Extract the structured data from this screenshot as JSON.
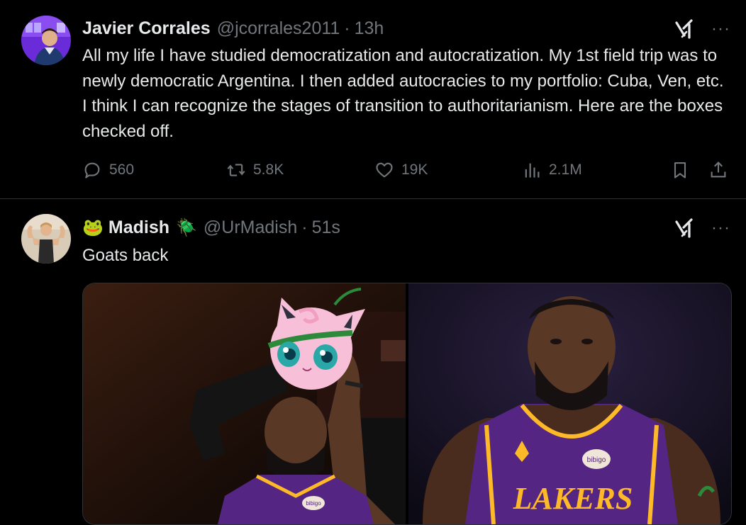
{
  "tweets": [
    {
      "author_name": "Javier Corrales",
      "handle": "@jcorrales2011",
      "separator": "·",
      "time": "13h",
      "text": "All my life I have studied democratization and autocratization. My 1st field trip was to newly democratic Argentina. I then added autocracies to my portfolio: Cuba, Ven, etc. I think I can recognize the stages of transition to authoritarianism. Here are the boxes checked off.",
      "more_label": "···",
      "stats": {
        "replies": "560",
        "reposts": "5.8K",
        "likes": "19K",
        "views": "2.1M"
      }
    },
    {
      "name_emoji_left": "🐸",
      "author_name": "Madish",
      "name_emoji_right": "🪲",
      "handle": "@UrMadish",
      "separator": "·",
      "time": "51s",
      "text": "Goats back",
      "more_label": "···",
      "images": [
        {
          "description": "Basketball player in purple Lakers jersey with Jigglypuff",
          "jersey_sponsor": "bibigo"
        },
        {
          "description": "Basketball player in purple Lakers jersey",
          "jersey_text": "LAKERS",
          "jersey_sponsor": "bibigo"
        }
      ]
    }
  ],
  "colors": {
    "background": "#000000",
    "text": "#e7e9ea",
    "muted": "#71767b",
    "border": "#2f3336",
    "lakers_purple": "#552583",
    "lakers_gold": "#fdb927"
  },
  "icons": [
    "grok-icon",
    "more-icon",
    "reply-icon",
    "repost-icon",
    "like-icon",
    "views-icon",
    "bookmark-icon",
    "share-icon"
  ]
}
